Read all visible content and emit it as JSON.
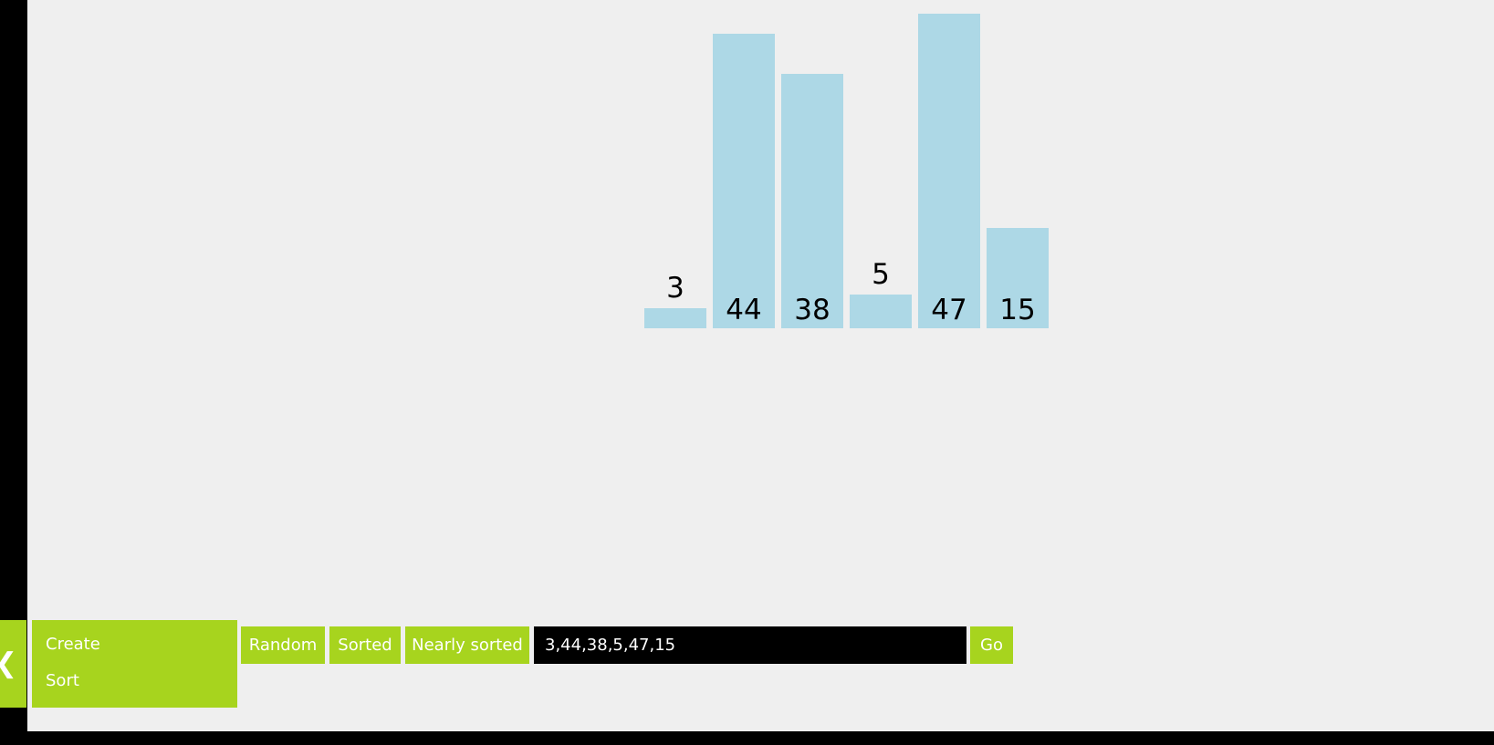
{
  "chart_data": {
    "type": "bar",
    "values": [
      3,
      44,
      38,
      5,
      47,
      15
    ],
    "bar_color": "#add8e6"
  },
  "menu": {
    "items": [
      "Create",
      "Sort"
    ]
  },
  "toolbar": {
    "random_label": "Random",
    "sorted_label": "Sorted",
    "nearly_sorted_label": "Nearly sorted",
    "input_value": "3,44,38,5,47,15",
    "go_label": "Go"
  },
  "collapse_tab": {
    "icon": "chevron-left-icon"
  },
  "colors": {
    "accent": "#a7d41e",
    "background": "#efefef",
    "frame": "#000000"
  }
}
